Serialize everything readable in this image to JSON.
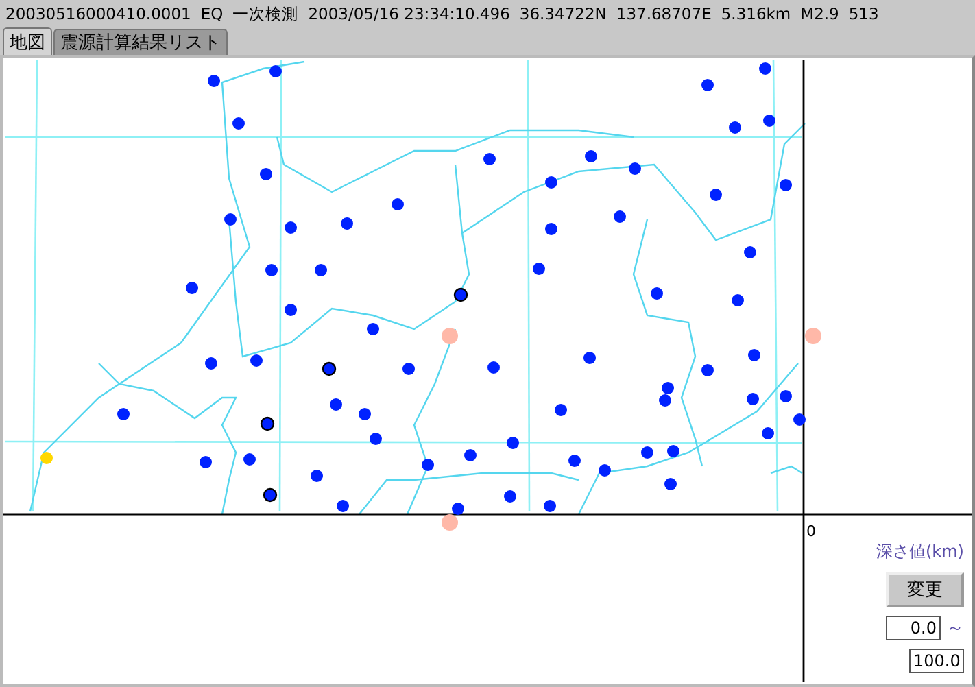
{
  "header": {
    "event_id": "20030516000410.0001",
    "type": "EQ",
    "mode": "一次検測",
    "datetime": "2003/05/16 23:34:10.496",
    "latitude": "36.34722N",
    "longitude": "137.68707E",
    "depth": "5.316km",
    "magnitude": "M2.9",
    "count": "513"
  },
  "tabs": [
    {
      "label": "地図",
      "selected": true
    },
    {
      "label": "震源計算結果リスト",
      "selected": false
    }
  ],
  "depth_panel": {
    "axis_zero": "0",
    "label": "深さ値(km)",
    "button": "変更",
    "min_value": "0.0",
    "range_sep": "～",
    "max_value": "100.0"
  }
}
